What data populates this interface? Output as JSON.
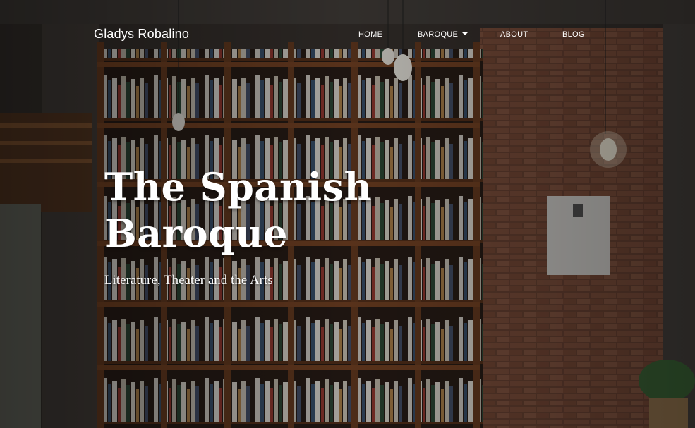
{
  "site": {
    "brand": "Gladys Robalino"
  },
  "nav": {
    "items": [
      {
        "label": "HOME"
      },
      {
        "label": "BAROQUE",
        "has_dropdown": true
      },
      {
        "label": "ABOUT"
      },
      {
        "label": "BLOG"
      }
    ]
  },
  "hero": {
    "title": "The Spanish Baroque",
    "subtitle": "Literature, Theater and the Arts"
  },
  "colors": {
    "text": "#ffffff",
    "overlay": "#000000",
    "brick": "#7a4a38",
    "wood": "#6b3e22"
  }
}
